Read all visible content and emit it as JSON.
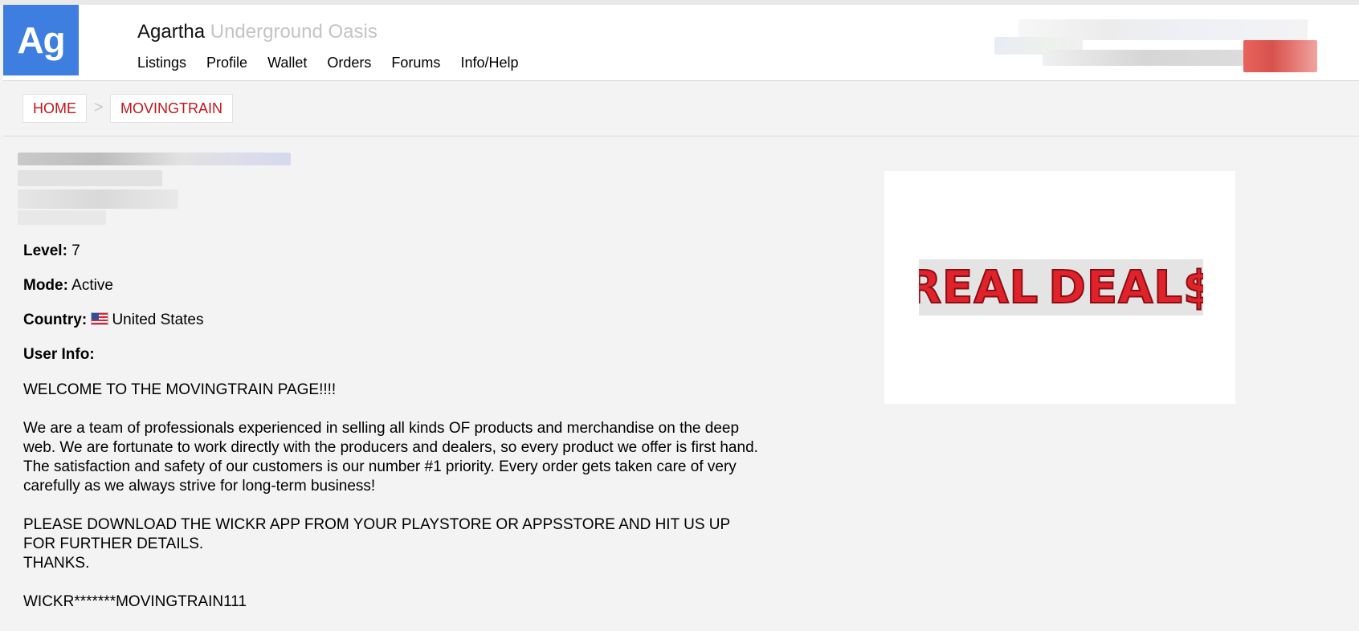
{
  "brand": {
    "logo_text": "Ag",
    "name": "Agartha",
    "tagline": "Underground Oasis"
  },
  "nav": [
    "Listings",
    "Profile",
    "Wallet",
    "Orders",
    "Forums",
    "Info/Help"
  ],
  "breadcrumb": {
    "home": "HOME",
    "separator": ">",
    "current": "MOVINGTRAIN"
  },
  "profile": {
    "level_label": "Level:",
    "level_value": "7",
    "mode_label": "Mode:",
    "mode_value": "Active",
    "country_label": "Country:",
    "country_value": "United States",
    "country_flag_icon": "us-flag-icon",
    "user_info_label": "User Info:",
    "user_info_paragraphs": [
      "WELCOME TO THE MOVINGTRAIN PAGE!!!!",
      "We are a team of professionals experienced in selling all kinds OF products and merchandise on the deep web. We are fortunate to work directly with the producers and dealers, so every product we offer is first hand. The satisfaction and safety of our customers is our number #1 priority. Every order gets taken care of very carefully as we always strive for long-term business!",
      "PLEASE DOWNLOAD THE WICKR APP FROM YOUR PLAYSTORE OR APPSSTORE AND HIT US UP FOR FURTHER DETAILS.\nTHANKS.",
      "WICKR*******MOVINGTRAIN111"
    ]
  },
  "banner": {
    "text_left": "REAL",
    "text_right": "DEAL$",
    "icon": "money-bag-icon"
  },
  "colors": {
    "logo_bg": "#3d7ee0",
    "crumb_text": "#c0151b",
    "tagline": "#c4c4c4",
    "banner_red": "#e0222a",
    "page_bg": "#f3f3f3"
  }
}
